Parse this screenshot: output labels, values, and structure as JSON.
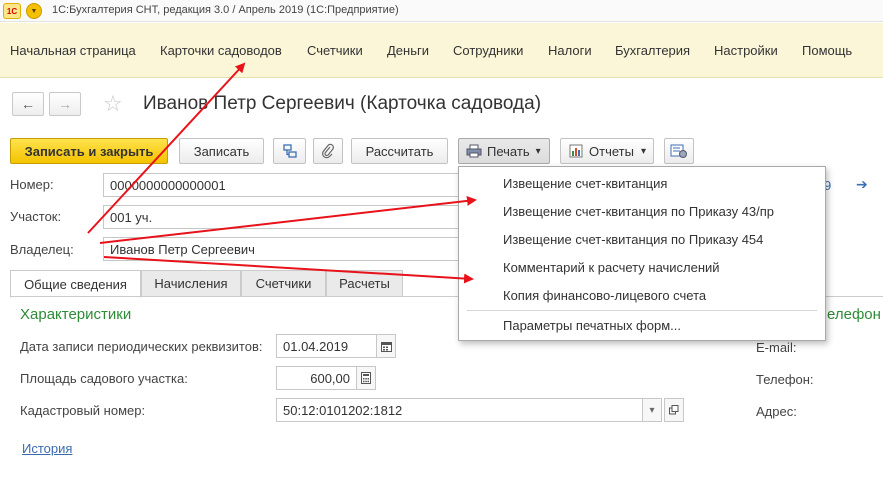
{
  "app": {
    "title": "1С:Бухгалтерия СНТ, редакция 3.0 / Апрель 2019  (1С:Предприятие)",
    "logo_text": "1С",
    "menu_glyph": "▼"
  },
  "sections": [
    {
      "label": "Начальная страница"
    },
    {
      "label": "Карточки садоводов"
    },
    {
      "label": "Счетчики"
    },
    {
      "label": "Деньги"
    },
    {
      "label": "Сотрудники"
    },
    {
      "label": "Налоги"
    },
    {
      "label": "Бухгалтерия"
    },
    {
      "label": "Настройки"
    },
    {
      "label": "Помощь"
    }
  ],
  "form": {
    "back_glyph": "🡐",
    "forward_glyph": "🡒",
    "star_glyph": "☆",
    "title": "Иванов Петр Сергеевич (Карточка садовода)"
  },
  "toolbar": {
    "save_close": "Записать и закрыть",
    "save": "Записать",
    "calculate": "Рассчитать",
    "print": "Печать",
    "reports": "Отчеты",
    "dropdown_glyph": "▾"
  },
  "fields": {
    "number_label": "Номер:",
    "number_value": "0000000000000001",
    "plot_label": "Участок:",
    "plot_value": "001 уч.",
    "owner_label": "Владелец:",
    "owner_value": "Иванов Петр Сергеевич",
    "right_fragment": "9"
  },
  "tabs": [
    {
      "label": "Общие сведения"
    },
    {
      "label": "Начисления"
    },
    {
      "label": "Счетчики"
    },
    {
      "label": "Расчеты"
    }
  ],
  "characteristics": {
    "title": "Характеристики",
    "date_label": "Дата записи периодических реквизитов:",
    "date_value": "01.04.2019",
    "area_label": "Площадь садового участка:",
    "area_value": "600,00",
    "cadastral_label": "Кадастровый номер:",
    "cadastral_value": "50:12:0101202:1812",
    "history_link": "История"
  },
  "contacts": {
    "title_fragment": "елефон",
    "email_label": "E-mail:",
    "phone_label": "Телефон:",
    "address_label": "Адрес:"
  },
  "print_menu": {
    "items": [
      {
        "label": "Извещение счет-квитанция"
      },
      {
        "label": "Извещение счет-квитанция по Приказу 43/пр"
      },
      {
        "label": "Извещение счет-квитанция по Приказу 454"
      },
      {
        "label": "Комментарий к расчету начислений"
      },
      {
        "label": "Копия финансово-лицевого счета"
      }
    ],
    "settings": "Параметры печатных форм..."
  },
  "colors": {
    "accent_yellow": "#f4c300",
    "sections_bg": "#fbf6d8",
    "group_green": "#2e8b37",
    "link_blue": "#3a6bb0",
    "annotation_red": "#e8121a"
  }
}
